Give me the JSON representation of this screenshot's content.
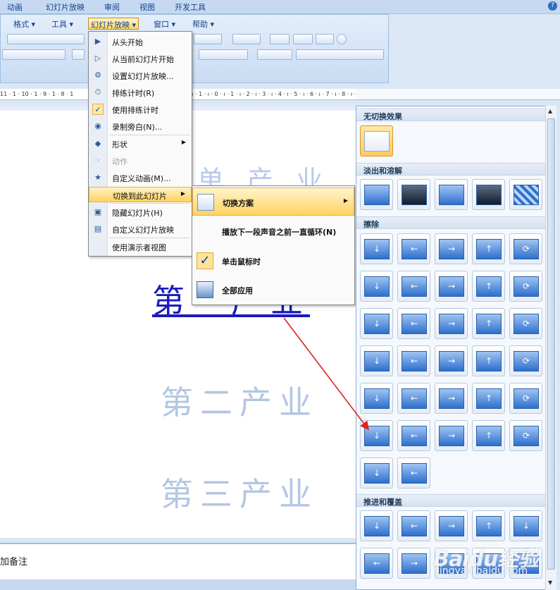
{
  "tabs": [
    "动画",
    "幻灯片放映",
    "审阅",
    "视图",
    "开发工具"
  ],
  "menubar": [
    "格式",
    "工具",
    "幻灯片放映",
    "窗口",
    "帮助"
  ],
  "ruler_text": "11 · 1 · 10 · 1 · 9 · 1 · 8 · 1",
  "ruler_right": "· 2 · ı · 1 · ı · 0 · ı · 1 · ı · 2 · ı · 3 · ı · 4 · ı · 5 · ı · 6 · ı · 7 · ı · 8 · ı · 9 · ı · 10 · ı · 11 · ı · 12 · ı",
  "menu": {
    "items": [
      {
        "label": "从头开始",
        "icon": "play-icon",
        "glyph": "▶"
      },
      {
        "label": "从当前幻灯片开始",
        "icon": "play-current-icon",
        "glyph": "▷"
      },
      {
        "label": "设置幻灯片放映...",
        "icon": "settings-icon",
        "glyph": "⚙"
      },
      {
        "label": "排练计时(R)",
        "icon": "timer-icon",
        "glyph": "⏱"
      },
      {
        "label": "使用排练计时",
        "icon": "checkmark-icon",
        "glyph": "✓"
      },
      {
        "label": "录制旁白(N)...",
        "icon": "microphone-icon",
        "glyph": "◉"
      },
      {
        "label": "形状",
        "icon": "shapes-icon",
        "glyph": "◆"
      },
      {
        "label": "动作",
        "icon": "action-icon",
        "glyph": "☞"
      },
      {
        "label": "自定义动画(M)...",
        "icon": "animation-icon",
        "glyph": "★"
      },
      {
        "label": "切换到此幻灯片",
        "icon": "transition-icon",
        "glyph": ""
      },
      {
        "label": "隐藏幻灯片(H)",
        "icon": "hide-slide-icon",
        "glyph": "▣"
      },
      {
        "label": "自定义幻灯片放映",
        "icon": "custom-show-icon",
        "glyph": "▤"
      },
      {
        "label": "使用演示者视图",
        "icon": "presenter-icon",
        "glyph": ""
      }
    ]
  },
  "submenu": {
    "items": [
      {
        "label": "切换方案",
        "icon": "scheme-icon"
      },
      {
        "label": "播放下一段声音之前一直循环(N)",
        "icon": ""
      },
      {
        "label": "单击鼠标时",
        "icon": "checkmark-icon"
      },
      {
        "label": "全部应用",
        "icon": "apply-all-icon"
      }
    ]
  },
  "slide": {
    "line1": "第一产业",
    "line2": "第二产业",
    "line3": "第三产业",
    "partial_title": "单 产 业"
  },
  "notes": "加备注",
  "gallery": {
    "sections": [
      "无切换效果",
      "淡出和溶解",
      "擦除",
      "推进和覆盖"
    ]
  },
  "watermark": {
    "brand": "Baidu经验",
    "url": "jingyan.baidu.com"
  }
}
